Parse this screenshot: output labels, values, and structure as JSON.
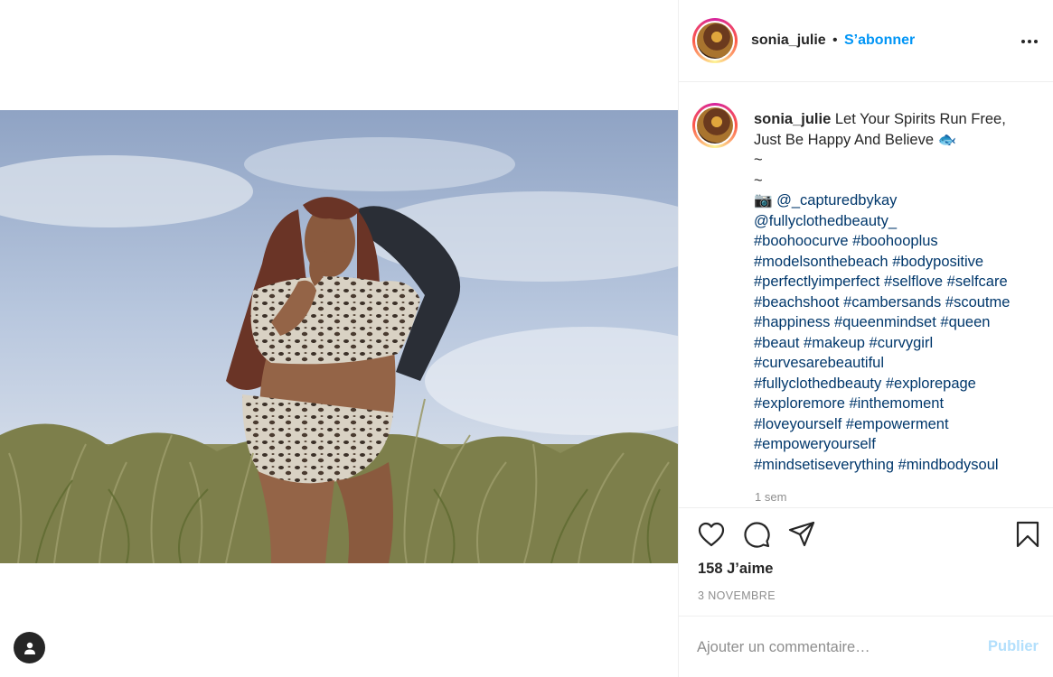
{
  "post": {
    "image_alt": "Femme en maillot de bain léopard dans les herbes des dunes",
    "header": {
      "username": "sonia_julie",
      "separator": "•",
      "follow_label": "S’abonner"
    },
    "caption": {
      "username": "sonia_julie",
      "lines": [
        "Let Your Spirits Run Free,",
        "Just Be Happy And Believe 🐟",
        "~",
        "~",
        "📷 @_capturedbykay",
        "@fullyclothedbeauty_",
        "#boohoocurve #boohooplus",
        "#modelsonthebeach #bodypositive",
        "#perfectlyimperfect #selflove #selfcare",
        "#beachshoot #cambersands #scoutme",
        "#happiness #queenmindset #queen",
        "#beaut #makeup #curvygirl",
        "#curvesarebeautiful",
        "#fullyclothedbeauty #explorepage",
        "#exploremore #inthemoment",
        "#loveyourself #empowerment",
        "#empoweryourself",
        "#mindsetiseverything #mindbodysoul"
      ],
      "time": "1 sem"
    },
    "likes": "158 J’aime",
    "date": "3 NOVEMBRE",
    "comment": {
      "placeholder": "Ajouter un commentaire…",
      "publish_label": "Publier"
    }
  },
  "icons": {
    "like": "heart-icon",
    "comment": "comment-icon",
    "share": "paper-plane-icon",
    "save": "bookmark-icon",
    "more": "more-options-icon",
    "tags": "user-tag-icon"
  },
  "colors": {
    "accent": "#0095f6",
    "publish_disabled": "#b2dffc",
    "text": "#262626",
    "muted": "#8e8e8e",
    "hashtag": "#00376b"
  }
}
